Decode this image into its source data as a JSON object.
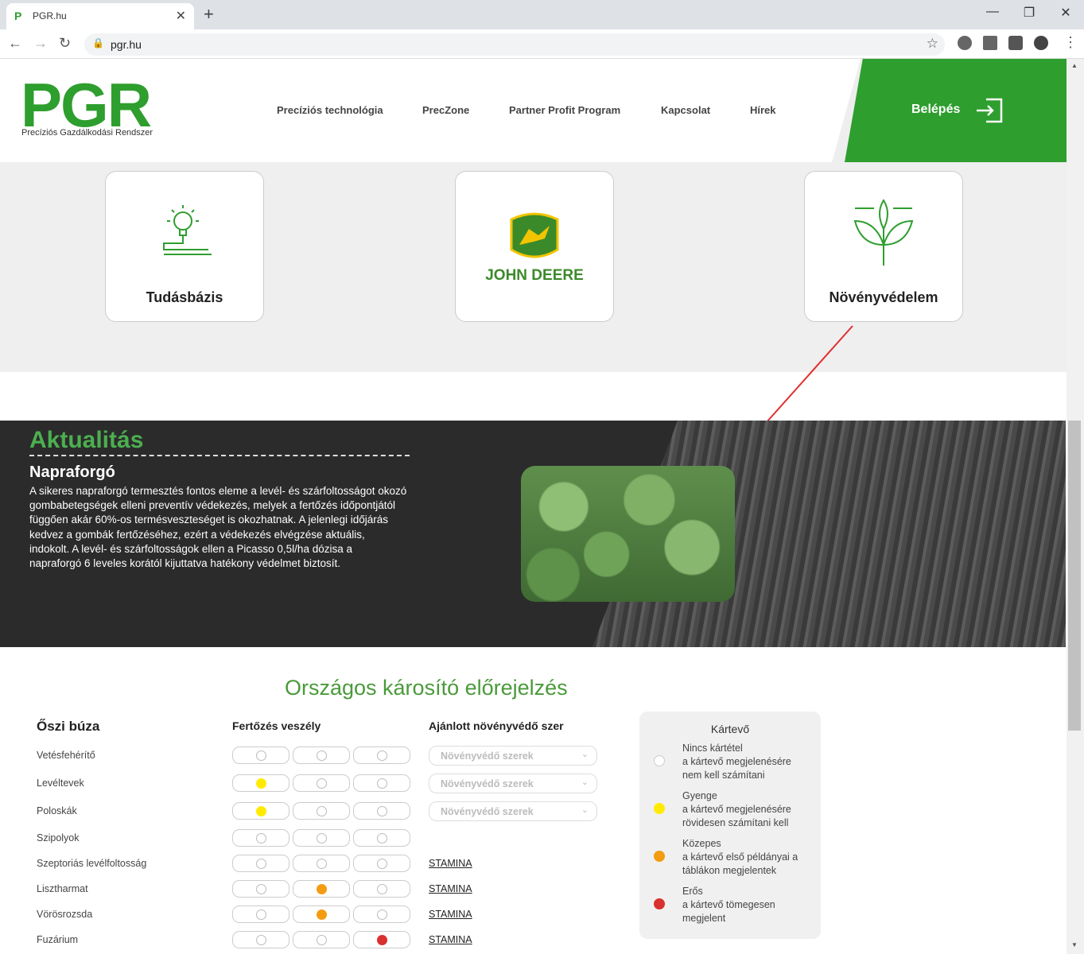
{
  "browser": {
    "tab_title": "PGR.hu",
    "url": "pgr.hu"
  },
  "header": {
    "logo": "PGR",
    "logo_sub": "Precíziós Gazdálkodási Rendszer",
    "nav": [
      "Precíziós technológia",
      "PrecZone",
      "Partner Profit Program",
      "Kapcsolat",
      "Hírek"
    ],
    "login": "Belépés",
    "colors": {
      "brand": "#2e9e2e"
    }
  },
  "cards": [
    {
      "label": "Tudásbázis",
      "icon": "lightbulb-icon"
    },
    {
      "label": "",
      "icon": "john-deere-logo",
      "brand_text": "JOHN DEERE"
    },
    {
      "label": "Növényvédelem",
      "icon": "plant-icon"
    }
  ],
  "news": {
    "title": "Aktualitás",
    "subtitle": "Napraforgó",
    "text": "A sikeres napraforgó termesztés fontos eleme a levél- és szárfoltosságot okozó gombabetegségek elleni preventív védekezés, melyek a fertőzés időpontjától függően akár 60%-os termésveszteséget is okozhatnak. A jelenlegi időjárás kedvez a gombák fertőzéséhez, ezért a védekezés elvégzése aktuális, indokolt. A levél- és szárfoltosságok ellen a Picasso 0,5l/ha dózisa a napraforgó 6 leveles korától kijuttatva hatékony védelmet biztosít."
  },
  "forecast": {
    "title": "Országos károsító előrejelzés",
    "crop": "Őszi búza",
    "col_risk": "Fertőzés veszély",
    "col_product": "Ajánlott növényvédő szer",
    "select_placeholder": "Növényvédő szerek",
    "rows": [
      {
        "name": "Vetésfehérítő",
        "level": [
          0,
          0,
          0
        ],
        "product": "select"
      },
      {
        "name": "Levéltevek",
        "level": [
          1,
          0,
          0
        ],
        "product": "select"
      },
      {
        "name": "Poloskák",
        "level": [
          1,
          0,
          0
        ],
        "product": "select"
      },
      {
        "name": "Szipolyok",
        "level": [
          0,
          0,
          0
        ],
        "product": ""
      },
      {
        "name": "Szeptoriás levélfoltosság",
        "level": [
          0,
          0,
          0
        ],
        "product": "STAMINA"
      },
      {
        "name": "Lisztharmat",
        "level": [
          0,
          2,
          0
        ],
        "product": "STAMINA"
      },
      {
        "name": "Vörösrozsda",
        "level": [
          0,
          2,
          0
        ],
        "product": "STAMINA"
      },
      {
        "name": "Fuzárium",
        "level": [
          0,
          0,
          3
        ],
        "product": "STAMINA"
      }
    ]
  },
  "legend": {
    "title": "Kártevő",
    "items": [
      {
        "text1": "Nincs kártétel",
        "text2": "a kártevő megjelenésére nem kell számítani",
        "color": "#ffffff"
      },
      {
        "text1": "Gyenge",
        "text2": "a kártevő megjelenésére rövidesen számítani kell",
        "color": "#ffeb00"
      },
      {
        "text1": "Közepes",
        "text2": "a kártevő első példányai a táblákon megjelentek",
        "color": "#f39c12"
      },
      {
        "text1": "Erős",
        "text2": "a kártevő tömegesen megjelent",
        "color": "#d93030"
      }
    ]
  }
}
